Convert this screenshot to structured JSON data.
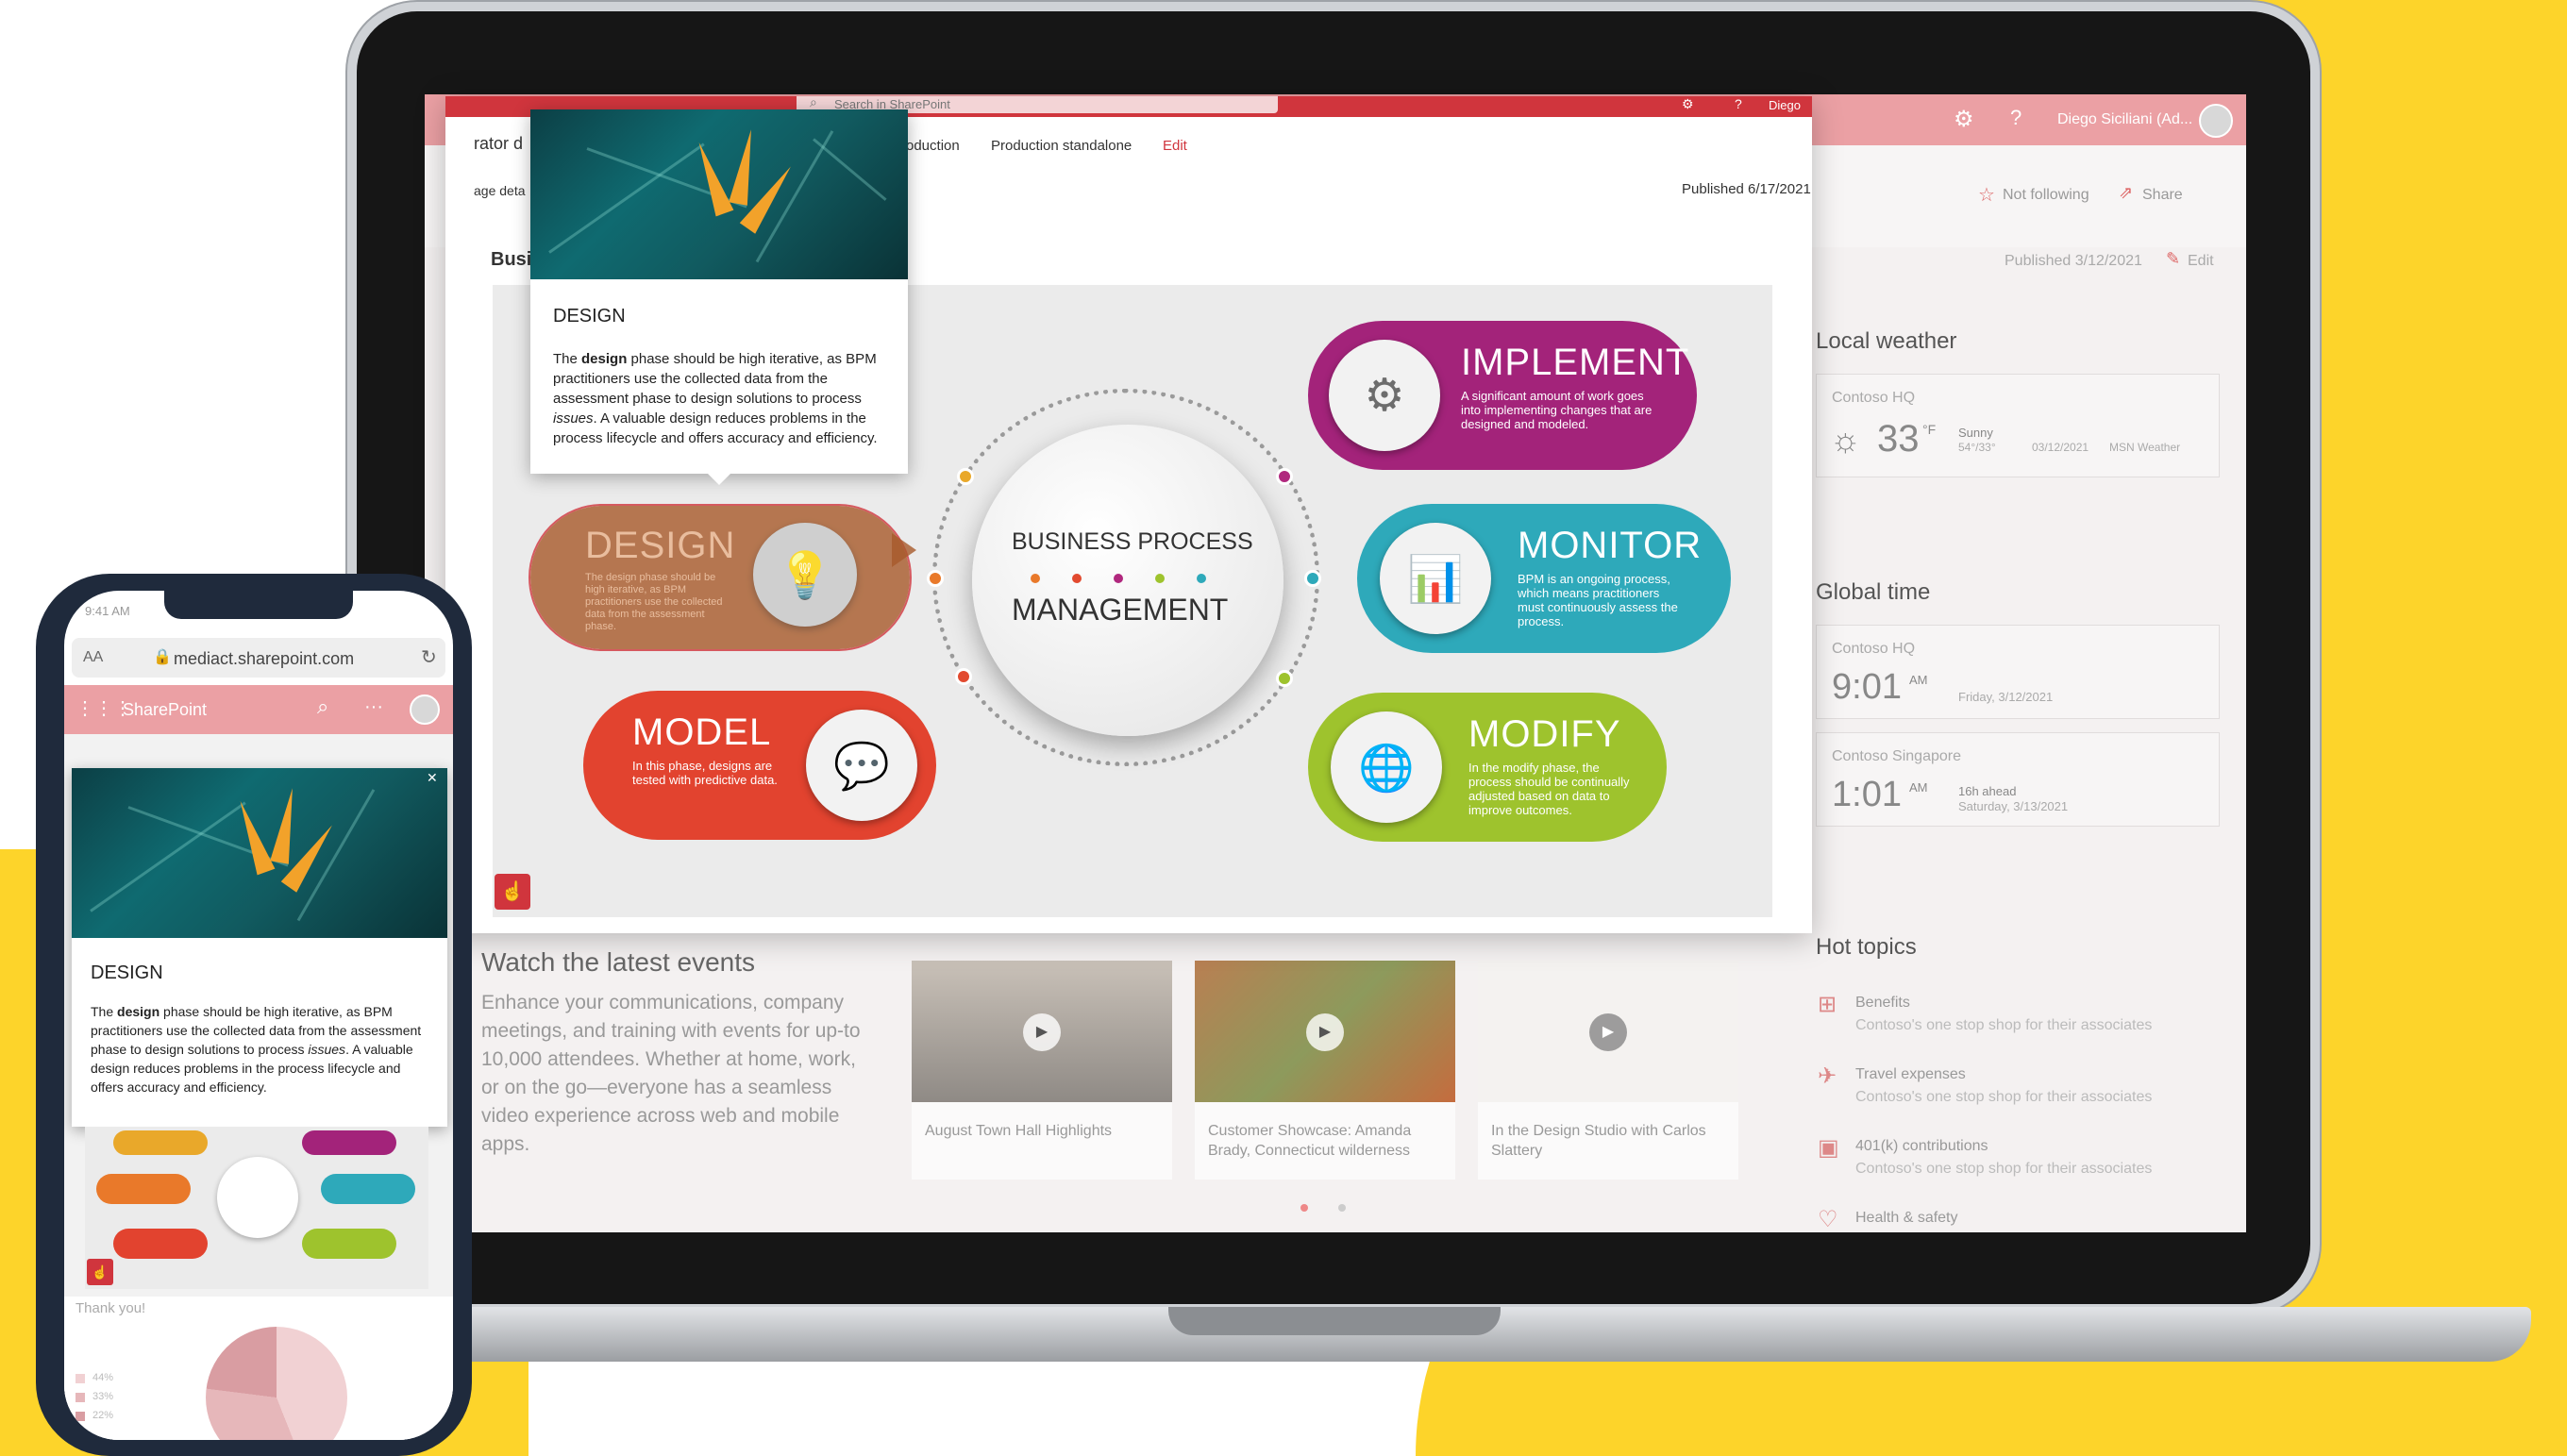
{
  "browser": {
    "search_placeholder": "Search in SharePoint",
    "user_short": "Diego",
    "user_full": "Diego Siciliani (Ad..."
  },
  "nav": {
    "partial_title": "rator d",
    "links": [
      "oduction",
      "Production standalone",
      "Edit"
    ],
    "page_details": "age deta",
    "section_partial": "Busi",
    "published_popup": "Published 6/17/2021",
    "not_following": "Not following",
    "share": "Share",
    "published_main": "Published 3/12/2021",
    "edit": "Edit"
  },
  "tooltip": {
    "title": "DESIGN",
    "bold_word": "design",
    "text_pre": "The ",
    "text_post": " phase should be high iterative, as BPM practitioners use the collected data from the assessment phase to design solutions to process ",
    "text_em": "issues",
    "text_end": ". A valuable design reduces problems in the process lifecycle and offers accuracy and efficiency."
  },
  "diagram": {
    "center_top": "BUSINESS PROCESS",
    "center_bottom": "MANAGEMENT",
    "phases": [
      {
        "name": "DESIGN",
        "desc": "The design phase should be high iterative, as BPM practitioners use the collected data from the assessment phase.",
        "color": "#a85a2a"
      },
      {
        "name": "IMPLEMENT",
        "desc": "A significant amount of work goes into implementing changes that are designed and modeled.",
        "color": "#a3237a"
      },
      {
        "name": "MONITOR",
        "desc": "BPM is an ongoing process, which means practitioners must continuously assess the process.",
        "color": "#2ea9ba"
      },
      {
        "name": "MODEL",
        "desc": "In this phase, designs are tested with predictive data.",
        "color": "#e2432f"
      },
      {
        "name": "MODIFY",
        "desc": "In the modify phase, the process should be continually adjusted based on data to improve outcomes.",
        "color": "#9ec32d"
      }
    ],
    "dot_colors": [
      "#e9792a",
      "#e24a2f",
      "#b0287e",
      "#9ec32d",
      "#2ea9ba"
    ]
  },
  "events": {
    "heading": "Watch the latest events",
    "body": "Enhance your communications, company meetings, and training with events for up-to 10,000 attendees. Whether at home, work, or on the go—everyone has a seamless video experience across web and mobile apps.",
    "videos": [
      "August Town Hall Highlights",
      "Customer Showcase: Amanda Brady, Connecticut wilderness",
      "In the Design Studio with Carlos Slattery"
    ]
  },
  "weather": {
    "title": "Local weather",
    "location": "Contoso HQ",
    "temp": "33",
    "unit": "°F",
    "condition": "Sunny",
    "range": "54°/33°",
    "date": "03/12/2021",
    "source": "MSN Weather"
  },
  "global_time": {
    "title": "Global time",
    "entries": [
      {
        "location": "Contoso HQ",
        "time": "9:01",
        "ampm": "AM",
        "date": "Friday, 3/12/2021",
        "offset": ""
      },
      {
        "location": "Contoso Singapore",
        "time": "1:01",
        "ampm": "AM",
        "date": "Saturday, 3/13/2021",
        "offset": "16h ahead"
      }
    ]
  },
  "hot_topics": {
    "title": "Hot topics",
    "items": [
      {
        "label": "Benefits",
        "sub": "Contoso's one stop shop for their associates"
      },
      {
        "label": "Travel expenses",
        "sub": "Contoso's one stop shop for their associates"
      },
      {
        "label": "401(k) contributions",
        "sub": "Contoso's one stop shop for their associates"
      },
      {
        "label": "Health & safety",
        "sub": ""
      }
    ]
  },
  "phone": {
    "time": "9:41 AM",
    "text_size": "AA",
    "url": "mediact.sharepoint.com",
    "app": "SharePoint",
    "tooltip_title": "DESIGN",
    "thank_you": "Thank you!",
    "legend": [
      "44%",
      "33%",
      "22%"
    ]
  }
}
